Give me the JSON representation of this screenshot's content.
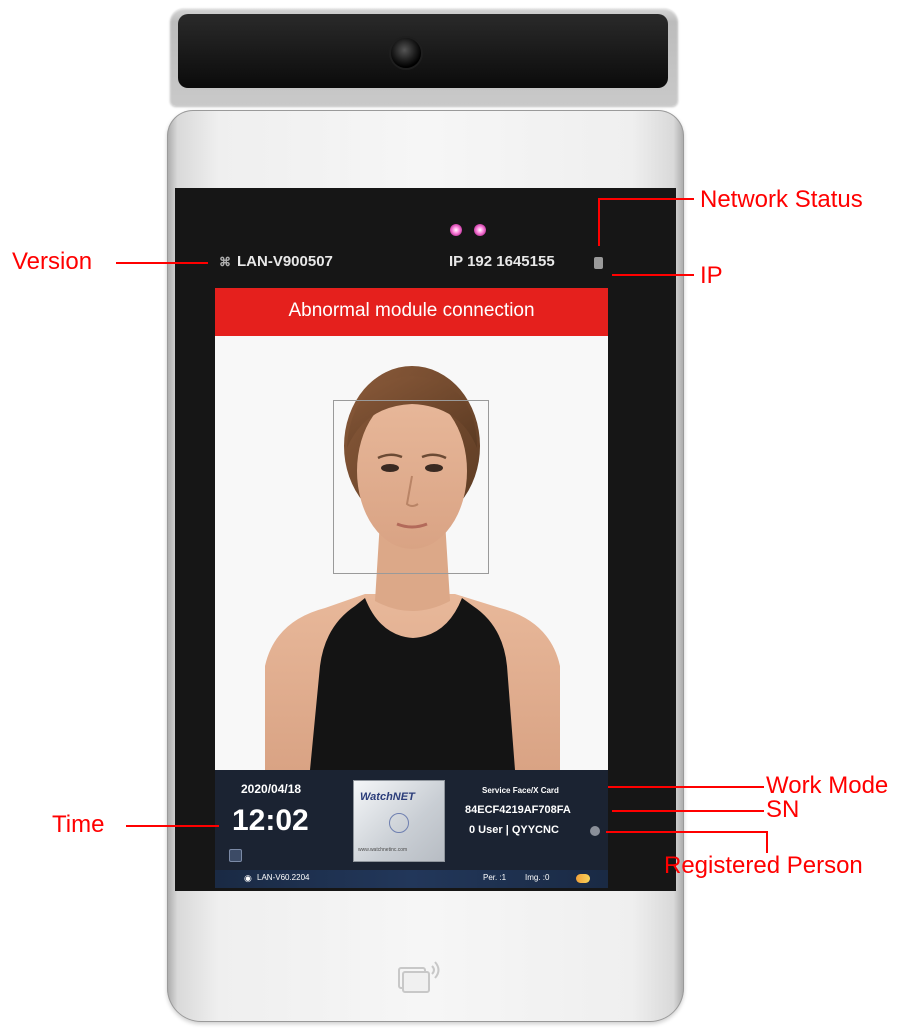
{
  "device": {
    "top_bar": {
      "version": "LAN-V900507",
      "ip": "IP 192 1645155"
    },
    "alert": "Abnormal module connection",
    "panel": {
      "date": "2020/04/18",
      "time": "12:02",
      "logo_text": "WatchNET",
      "logo_url": "www.watchnetinc.com",
      "work_mode": "Service Face/X Card",
      "sn": "84ECF4219AF708FA",
      "registered": "0 User | QYYCNC"
    },
    "status_bar": {
      "version": "LAN-V60.2204",
      "per": "Per. :1",
      "img": "Img. :0"
    }
  },
  "annotations": {
    "version": "Version",
    "network_status": "Network Status",
    "ip": "IP",
    "time": "Time",
    "work_mode": "Work Mode",
    "sn": "SN",
    "registered_person": "Registered Person"
  },
  "colors": {
    "annotation": "#ff0000",
    "alert_banner": "#e5201d",
    "panel": "#1b2332"
  }
}
